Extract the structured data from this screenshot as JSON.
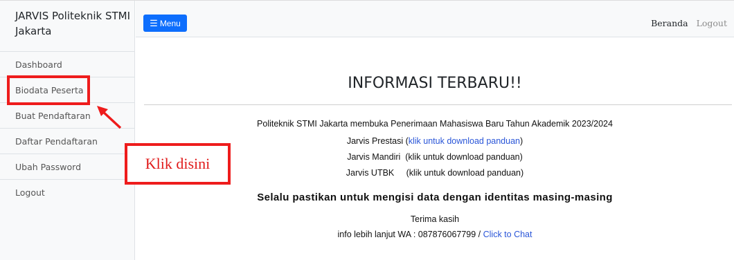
{
  "sidebar": {
    "brand": "JARVIS Politeknik STMI Jakarta",
    "items": [
      {
        "label": "Dashboard"
      },
      {
        "label": "Biodata Peserta"
      },
      {
        "label": "Buat Pendaftaran"
      },
      {
        "label": "Daftar Pendaftaran"
      },
      {
        "label": "Ubah Password"
      },
      {
        "label": "Logout"
      }
    ]
  },
  "navbar": {
    "menu_label": "Menu",
    "menu_icon": "hamburger-icon",
    "links": {
      "beranda": "Beranda",
      "logout": "Logout"
    }
  },
  "main": {
    "title": "INFORMASI TERBARU!!",
    "announcement": "Politeknik STMI Jakarta membuka Penerimaan Mahasiswa Baru Tahun Akademik 2023/2024",
    "jalur": [
      {
        "name": "Jarvis Prestasi",
        "link_text": "klik untuk download panduan"
      },
      {
        "name": "Jarvis Mandiri",
        "link_text": "klik untuk download panduan"
      },
      {
        "name": "Jarvis UTBK",
        "link_text": "klik untuk download panduan"
      }
    ],
    "reminder": "Selalu pastikan untuk mengisi data dengan identitas masing-masing",
    "thanks": "Terima kasih",
    "wa_text": "info lebih lanjut WA : 087876067799 / ",
    "chat_link": "Click to Chat"
  },
  "annotation": {
    "label": "Klik disini",
    "color": "#ee1c1c"
  },
  "colors": {
    "primary": "#0d6efd",
    "link": "#2955d8",
    "annotation_red": "#ee1c1c"
  }
}
